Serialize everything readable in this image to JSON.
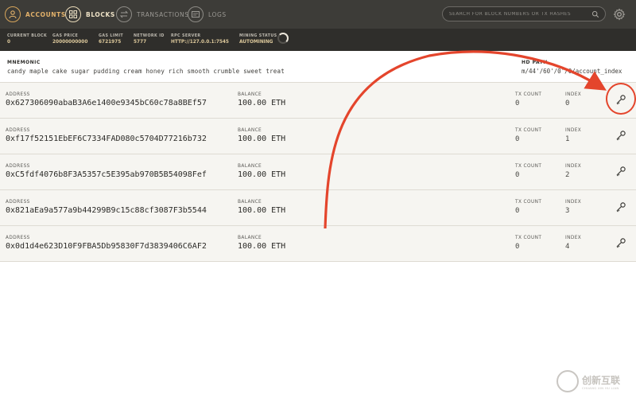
{
  "nav": {
    "items": [
      {
        "label": "ACCOUNTS",
        "icon": "accounts-icon"
      },
      {
        "label": "BLOCKS",
        "icon": "blocks-icon"
      },
      {
        "label": "TRANSACTIONS",
        "icon": "transactions-icon"
      },
      {
        "label": "LOGS",
        "icon": "logs-icon"
      }
    ],
    "search_placeholder": "SEARCH FOR BLOCK NUMBERS OR TX HASHES"
  },
  "status": {
    "current_block": {
      "label": "CURRENT BLOCK",
      "value": "0"
    },
    "gas_price": {
      "label": "GAS PRICE",
      "value": "20000000000"
    },
    "gas_limit": {
      "label": "GAS LIMIT",
      "value": "6721975"
    },
    "network_id": {
      "label": "NETWORK ID",
      "value": "5777"
    },
    "rpc_server": {
      "label": "RPC SERVER",
      "value": "HTTP://127.0.0.1:7545"
    },
    "mining_status": {
      "label": "MINING STATUS",
      "value": "AUTOMINING"
    }
  },
  "mnemonic": {
    "title": "MNEMONIC",
    "words": "candy maple cake sugar pudding cream honey rich smooth crumble sweet treat",
    "hd_title": "HD PATH",
    "hd_value": "m/44'/60'/0'/0/account_index"
  },
  "labels": {
    "address": "ADDRESS",
    "balance": "BALANCE",
    "tx_count": "TX COUNT",
    "index": "INDEX"
  },
  "accounts": [
    {
      "address": "0x627306090abaB3A6e1400e9345bC60c78a8BEf57",
      "balance": "100.00 ETH",
      "tx_count": "0",
      "index": "0"
    },
    {
      "address": "0xf17f52151EbEF6C7334FAD080c5704D77216b732",
      "balance": "100.00 ETH",
      "tx_count": "0",
      "index": "1"
    },
    {
      "address": "0xC5fdf4076b8F3A5357c5E395ab970B5B54098Fef",
      "balance": "100.00 ETH",
      "tx_count": "0",
      "index": "2"
    },
    {
      "address": "0x821aEa9a577a9b44299B9c15c88cf3087F3b5544",
      "balance": "100.00 ETH",
      "tx_count": "0",
      "index": "3"
    },
    {
      "address": "0x0d1d4e623D10F9FBA5Db95830F7d3839406C6AF2",
      "balance": "100.00 ETH",
      "tx_count": "0",
      "index": "4"
    }
  ],
  "colors": {
    "topbar": "#3d3c38",
    "statusbar": "#2f2e2b",
    "accent": "#e2b16a",
    "annotation": "#e4452c"
  },
  "watermark": {
    "text": "创新互联",
    "sub": "CHUANG XIN HU LIAN"
  }
}
